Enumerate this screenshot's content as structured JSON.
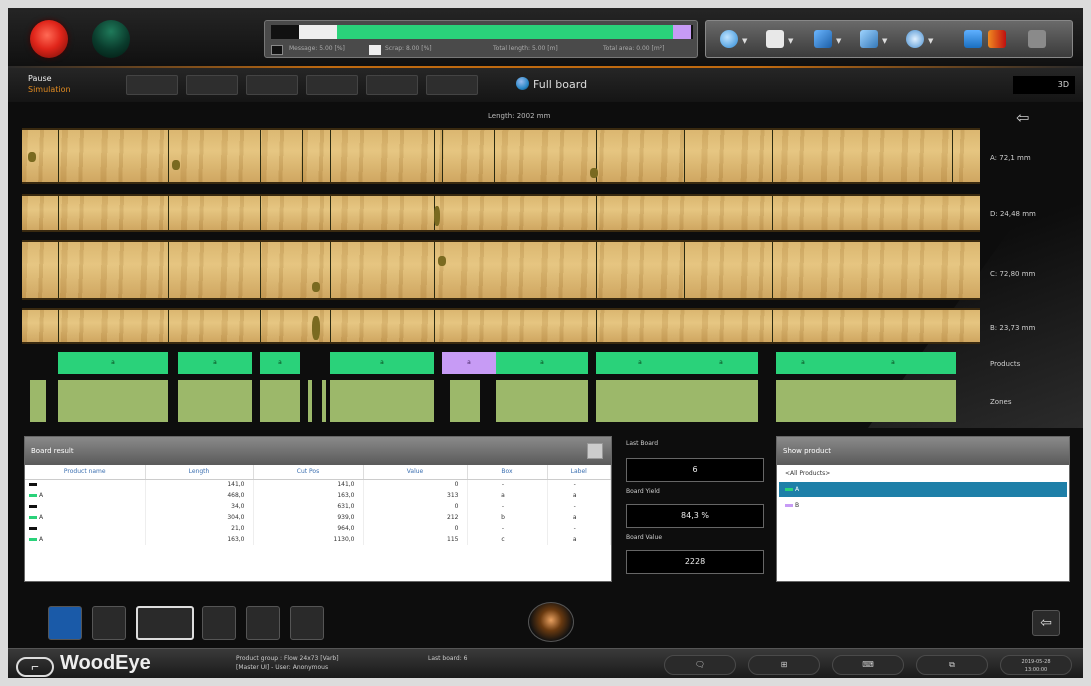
{
  "topbar": {
    "progress_legend": {
      "message": "Message: 5.00 [%]",
      "scrap": "Scrap: 8.00 [%]",
      "total_length": "Total length: 5.00 [m]",
      "total_area": "Total area: 0.00 [m²]"
    }
  },
  "subbar": {
    "mode_name": "Pause",
    "mode_sub": "Simulation",
    "view_title": "Full board",
    "view_mode": "3D"
  },
  "board_view": {
    "length_label": "Length: 2002 mm",
    "board_labels": [
      "A: 72,1 mm",
      "D: 24,48 mm",
      "C: 72,80 mm",
      "B: 23,73 mm"
    ],
    "products_label": "Products",
    "zones_label": "Zones"
  },
  "board_result": {
    "title": "Board result",
    "columns": [
      "Product name",
      "Length",
      "Cut Pos",
      "Value",
      "Box",
      "Label"
    ],
    "rows": [
      {
        "name": "",
        "length": "141,0",
        "cutpos": "141,0",
        "value": "0",
        "box": "-",
        "label": "-"
      },
      {
        "name": "A",
        "length": "468,0",
        "cutpos": "163,0",
        "value": "313",
        "box": "a",
        "label": "a"
      },
      {
        "name": "",
        "length": "34,0",
        "cutpos": "631,0",
        "value": "0",
        "box": "-",
        "label": "-"
      },
      {
        "name": "A",
        "length": "304,0",
        "cutpos": "939,0",
        "value": "212",
        "box": "b",
        "label": "a"
      },
      {
        "name": "",
        "length": "21,0",
        "cutpos": "964,0",
        "value": "0",
        "box": "-",
        "label": "-"
      },
      {
        "name": "A",
        "length": "163,0",
        "cutpos": "1130,0",
        "value": "115",
        "box": "c",
        "label": "a"
      }
    ]
  },
  "stats": {
    "last_board_label": "Last Board",
    "last_board_value": "6",
    "board_yield_label": "Board Yield",
    "board_yield_value": "84,3 %",
    "board_value_label": "Board Value",
    "board_value_value": "2228"
  },
  "show_product": {
    "title": "Show product",
    "items": [
      "<All Products>",
      "A",
      "B"
    ]
  },
  "footer": {
    "logo_text": "WoodEye",
    "product_group": "Product group : Flow 24x73 [Varb]",
    "master": "[Master UI] - User: Anonymous",
    "last_board": "Last board: 6",
    "clock_date": "2019-05-28",
    "clock_time": "13:00:00"
  },
  "colors": {
    "product_green": "#2ad27a",
    "product_purple": "#c79bf5",
    "zone_green": "#9cb86a",
    "accent_orange": "#e08a20"
  },
  "icons": [
    "search-icon",
    "monitor-icon",
    "arrow-icon",
    "network-icon",
    "settings-icon",
    "lock-icon",
    "play-icon",
    "tools-icon"
  ]
}
